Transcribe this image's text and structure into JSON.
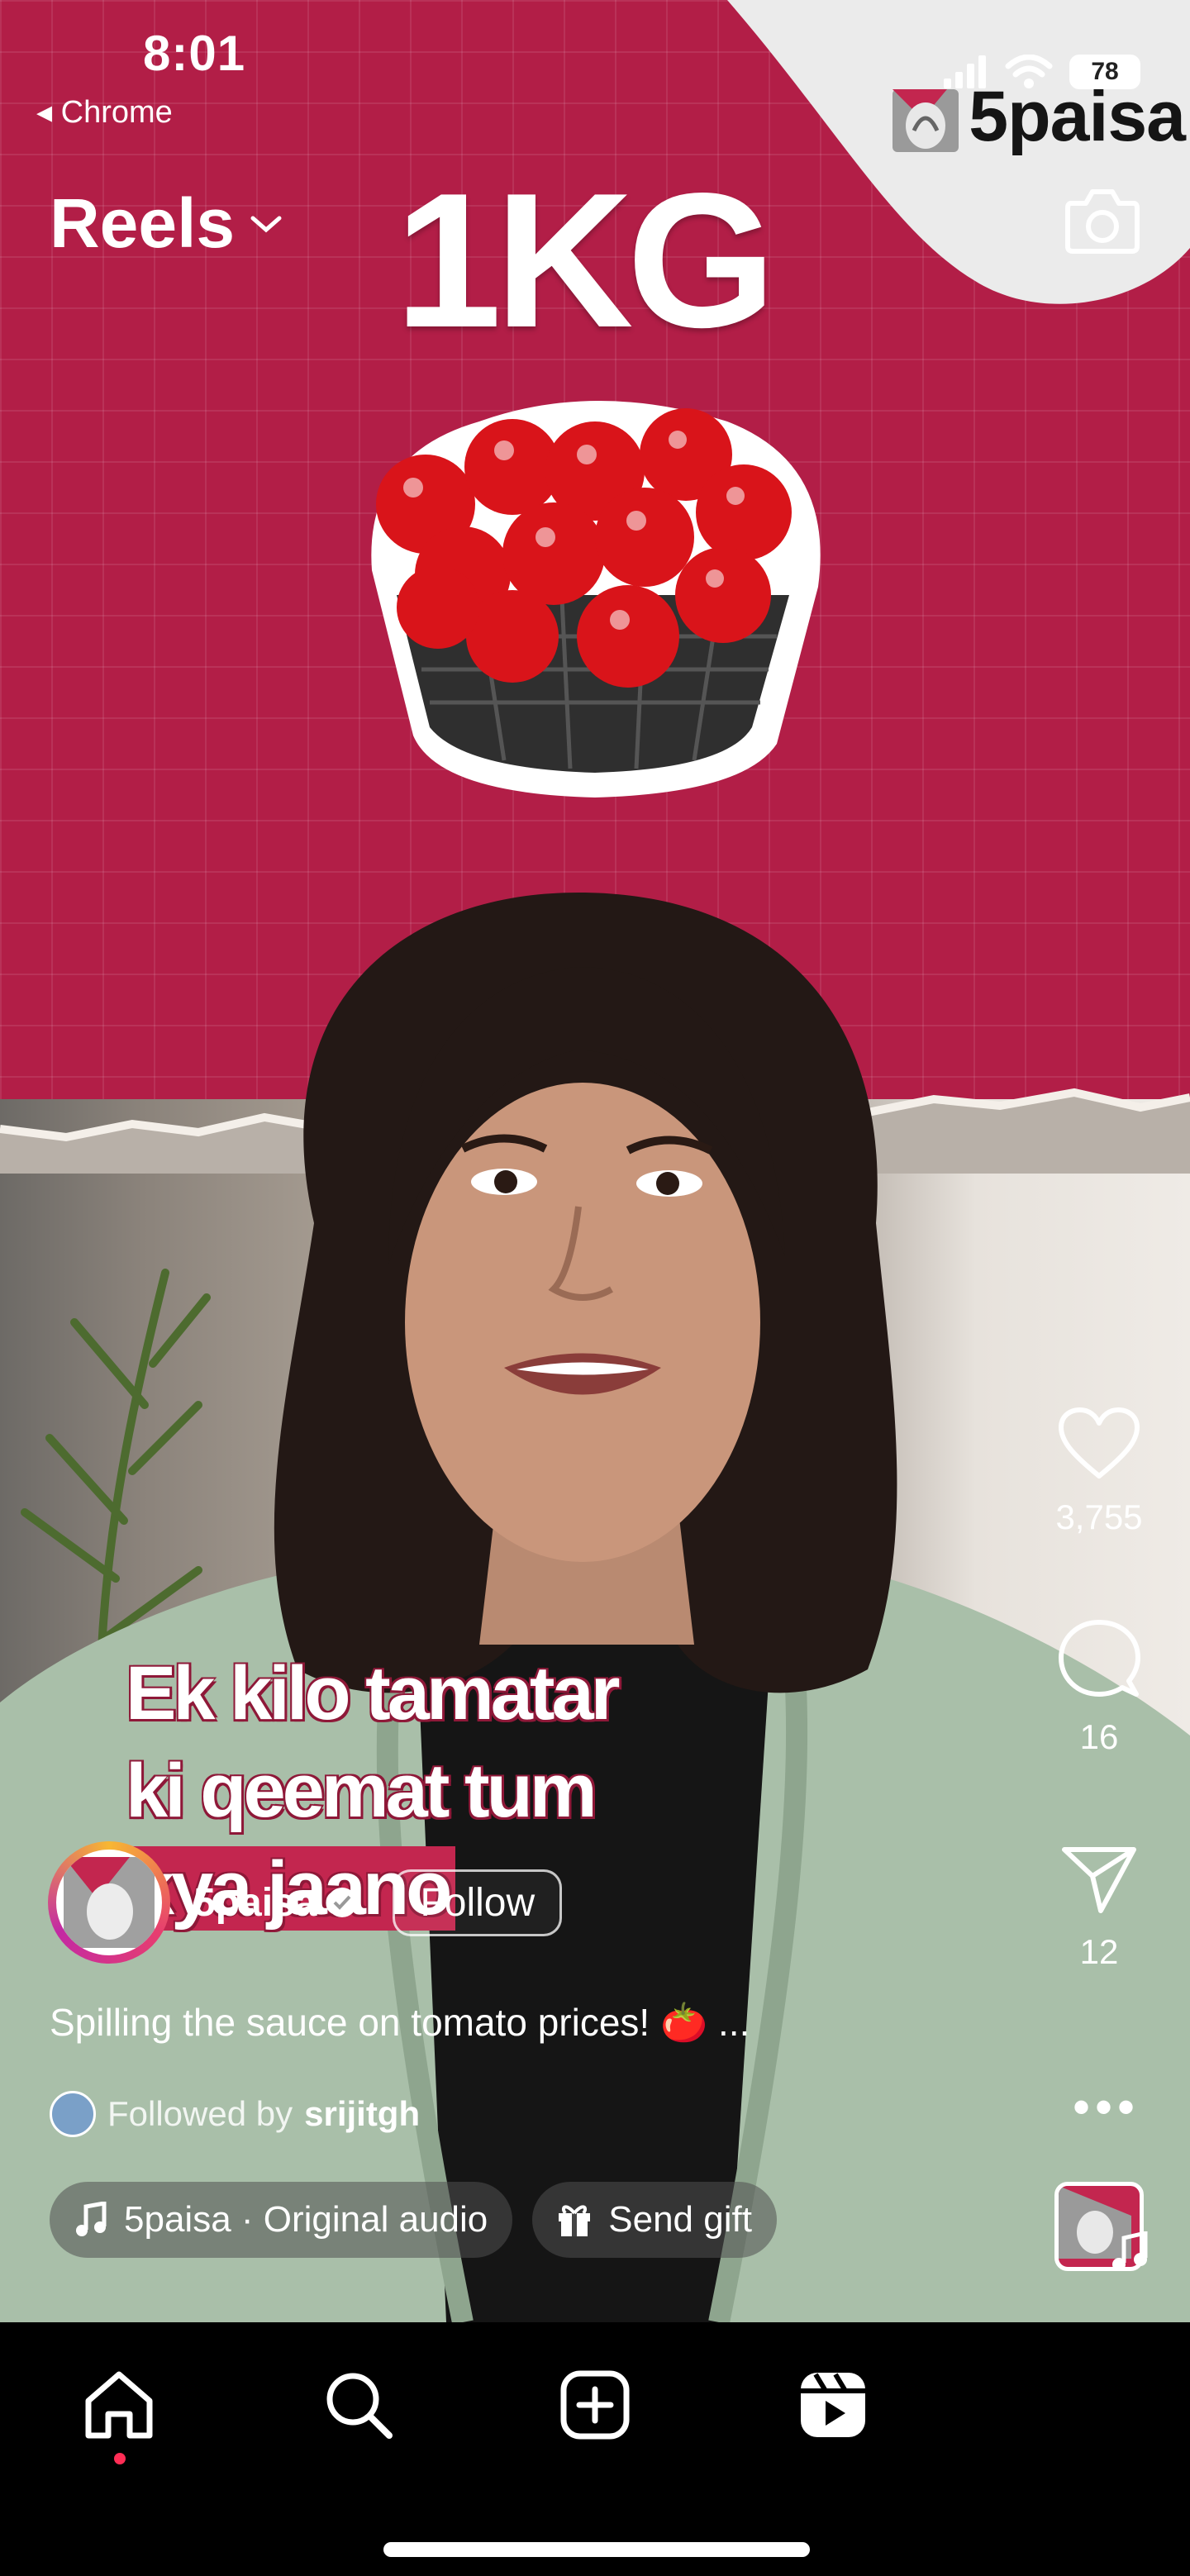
{
  "status": {
    "time": "8:01",
    "back_app": "◂ Chrome",
    "battery": "78"
  },
  "brand": {
    "name": "5paisa"
  },
  "header": {
    "title": "Reels"
  },
  "video": {
    "headline": "1KG",
    "subtitles": [
      "Ek kilo tamatar",
      "ki qeemat tum",
      "kya jaano"
    ]
  },
  "actions": {
    "likes": "3,755",
    "comments": "16",
    "shares": "12"
  },
  "post": {
    "username": "5paisa",
    "follow_label": "Follow",
    "description": "Spilling the sauce on tomato prices! 🍅 ...",
    "followed_prefix": "Followed by",
    "followed_user": "srijitgh",
    "audio": "5paisa · Original audio",
    "gift": "Send gift"
  },
  "colors": {
    "background": "#b21e47",
    "accent": "#ff2d55"
  },
  "icons": [
    "heart-icon",
    "comment-icon",
    "share-icon",
    "more-icon",
    "music-note-icon",
    "gift-icon",
    "camera-icon",
    "home-icon",
    "search-icon",
    "create-icon",
    "reels-icon"
  ]
}
